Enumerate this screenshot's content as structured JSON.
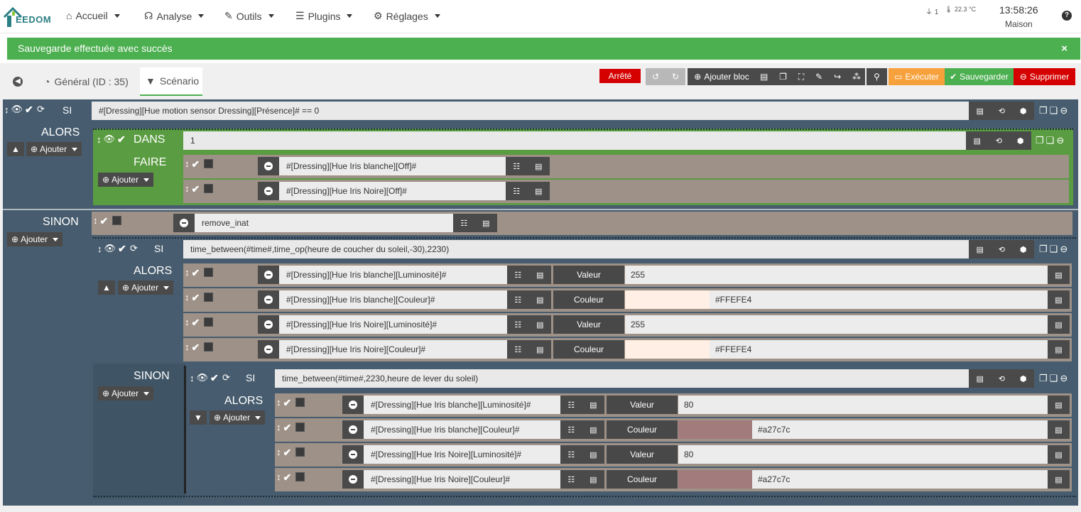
{
  "app": {
    "logo_text": "EEDOM"
  },
  "nav": {
    "items": [
      {
        "label": "Accueil",
        "icon": "home-icon"
      },
      {
        "label": "Analyse",
        "icon": "stethoscope-icon"
      },
      {
        "label": "Outils",
        "icon": "wrench-icon"
      },
      {
        "label": "Plugins",
        "icon": "list-icon"
      },
      {
        "label": "Réglages",
        "icon": "gear-icon"
      }
    ],
    "status": {
      "plug_count": "1",
      "temp": "22.3 °C",
      "time": "13:58:26",
      "place": "Maison"
    }
  },
  "alert": {
    "message": "Sauvegarde effectuée avec succès",
    "close": "×"
  },
  "tabs": {
    "general": "Général (ID : 35)",
    "scenario": "Scénario"
  },
  "toolbar": {
    "state": "Arrêté",
    "add_block": "Ajouter bloc",
    "execute": "Exécuter",
    "save": "Sauvegarder",
    "delete": "Supprimer"
  },
  "colors": {
    "green": "#4caf50",
    "blue_dark": "#475c6e",
    "red": "#d50000",
    "orange": "#f7a13c"
  },
  "scenario": {
    "if1": {
      "keyword": "SI",
      "condition": "#[Dressing][Hue motion sensor Dressing][Présence]# == 0"
    },
    "then1": {
      "label": "ALORS",
      "add": "Ajouter"
    },
    "in1": {
      "keyword": "DANS",
      "value": "1",
      "do_label": "FAIRE",
      "add": "Ajouter",
      "commands": [
        "#[Dressing][Hue Iris blanche][Off]#",
        "#[Dressing][Hue Iris Noire][Off]#"
      ]
    },
    "else1": {
      "label": "SINON",
      "add": "Ajouter",
      "command": "remove_inat"
    },
    "if2": {
      "keyword": "SI",
      "condition": "time_between(#time#,time_op(heure de coucher du soleil,-30),2230)",
      "then_label": "ALORS",
      "add": "Ajouter",
      "commands": [
        {
          "cmd": "#[Dressing][Hue Iris blanche][Luminosité]#",
          "type": "Valeur",
          "value": "255"
        },
        {
          "cmd": "#[Dressing][Hue Iris blanche][Couleur]#",
          "type": "Couleur",
          "value": "#FFEFE4",
          "swatch": "#ffefe4"
        },
        {
          "cmd": "#[Dressing][Hue Iris Noire][Luminosité]#",
          "type": "Valeur",
          "value": "255"
        },
        {
          "cmd": "#[Dressing][Hue Iris Noire][Couleur]#",
          "type": "Couleur",
          "value": "#FFEFE4",
          "swatch": "#ffefe4"
        }
      ]
    },
    "else2": {
      "label": "SINON",
      "add": "Ajouter"
    },
    "if3": {
      "keyword": "SI",
      "condition": "time_between(#time#,2230,heure de lever du soleil)",
      "then_label": "ALORS",
      "add": "Ajouter",
      "commands": [
        {
          "cmd": "#[Dressing][Hue Iris blanche][Luminosité]#",
          "type": "Valeur",
          "value": "80"
        },
        {
          "cmd": "#[Dressing][Hue Iris blanche][Couleur]#",
          "type": "Couleur",
          "value": "#a27c7c",
          "swatch": "#a27c7c"
        },
        {
          "cmd": "#[Dressing][Hue Iris Noire][Luminosité]#",
          "type": "Valeur",
          "value": "80"
        },
        {
          "cmd": "#[Dressing][Hue Iris Noire][Couleur]#",
          "type": "Couleur",
          "value": "#a27c7c",
          "swatch": "#a27c7c"
        }
      ]
    }
  }
}
